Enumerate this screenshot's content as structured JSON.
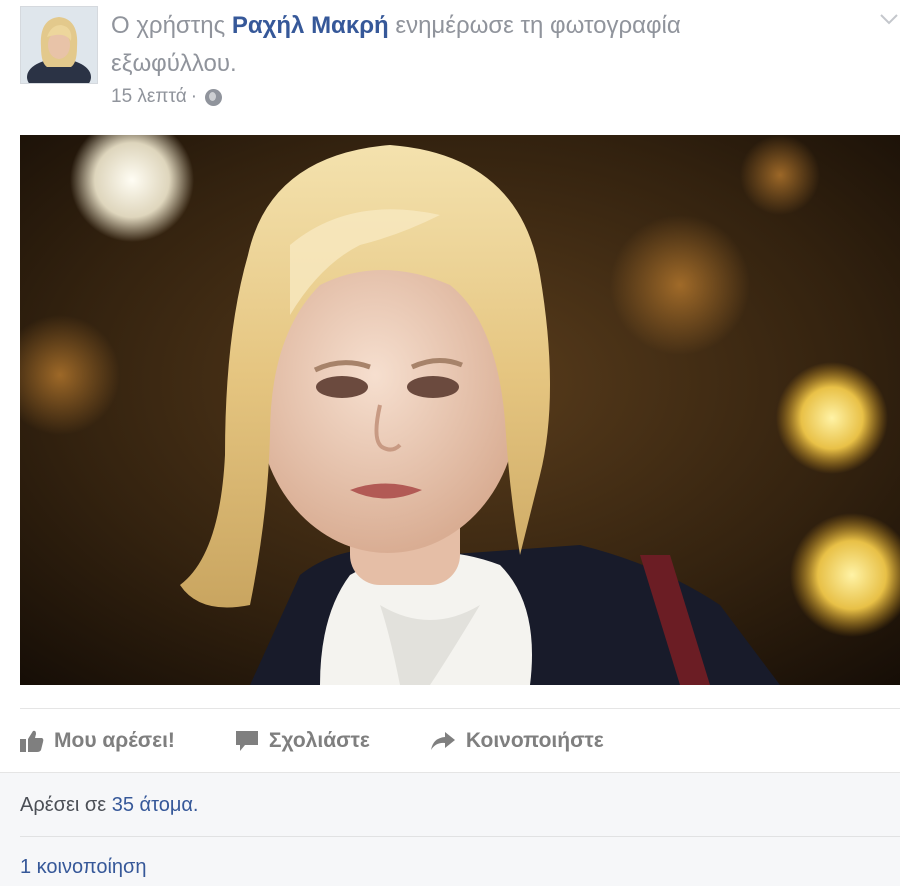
{
  "post": {
    "prefix": "Ο χρήστης ",
    "author": "Ραχήλ Μακρή",
    "action_line1": " ενημέρωσε τη φωτογραφία",
    "action_line2": "εξωφύλλου.",
    "time": "15 λεπτά",
    "time_sep": " · ",
    "privacy_icon": "globe-icon"
  },
  "actions": {
    "like_label": "Μου αρέσει!",
    "comment_label": "Σχολιάστε",
    "share_label": "Κοινοποιήστε"
  },
  "summary": {
    "likes_prefix": "Αρέσει σε ",
    "likes_count": "35 άτομα.",
    "shares": "1 κοινοποίηση"
  },
  "colors": {
    "link": "#365899",
    "muted": "#90949c",
    "action": "#7f7f7f",
    "summary_bg": "#f6f7f9"
  }
}
